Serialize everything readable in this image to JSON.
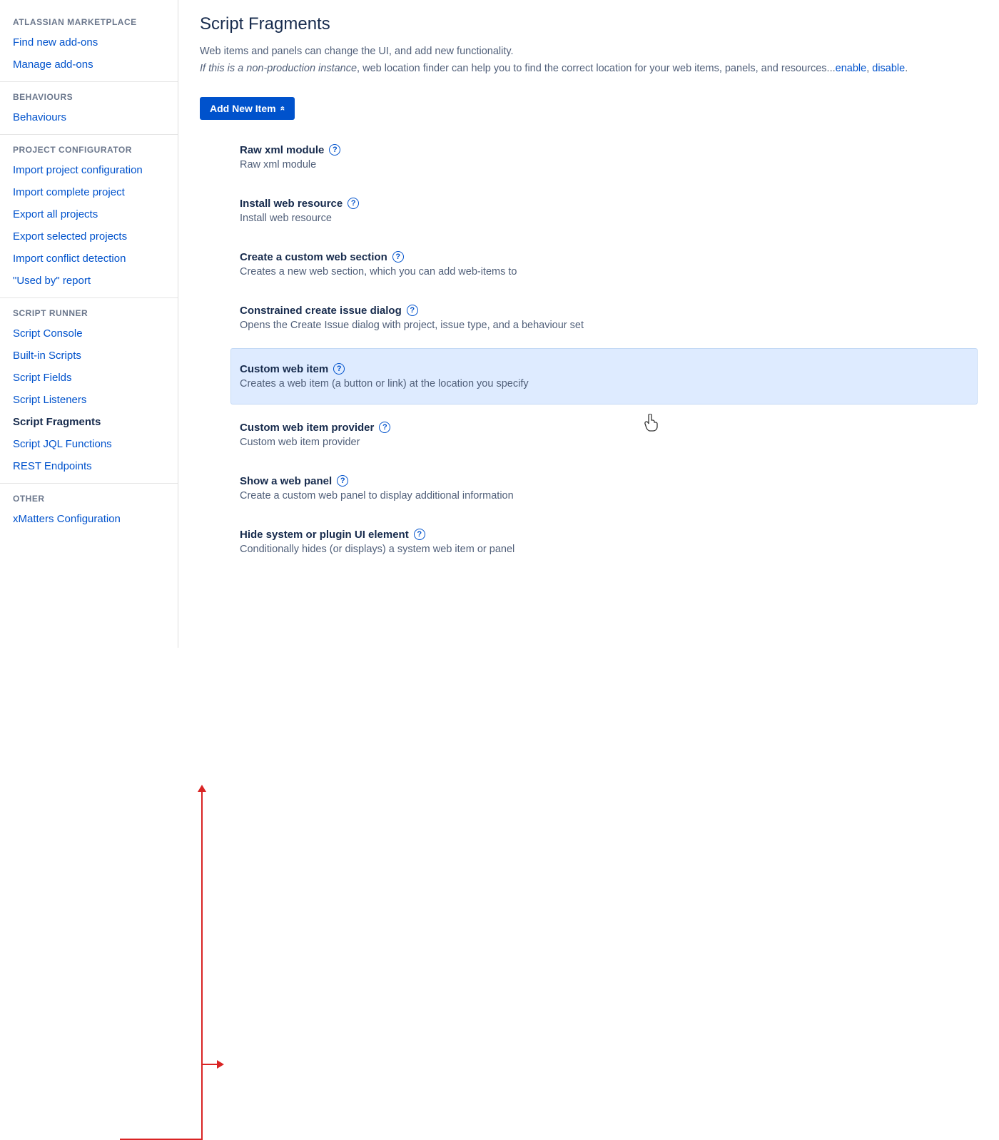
{
  "sidebar": {
    "groups": [
      {
        "header": "ATLASSIAN MARKETPLACE",
        "items": [
          {
            "label": "Find new add-ons",
            "name": "find-new-addons"
          },
          {
            "label": "Manage add-ons",
            "name": "manage-addons"
          }
        ]
      },
      {
        "header": "BEHAVIOURS",
        "items": [
          {
            "label": "Behaviours",
            "name": "behaviours"
          }
        ]
      },
      {
        "header": "PROJECT CONFIGURATOR",
        "items": [
          {
            "label": "Import project configuration",
            "name": "import-project-config"
          },
          {
            "label": "Import complete project",
            "name": "import-complete-project"
          },
          {
            "label": "Export all projects",
            "name": "export-all-projects"
          },
          {
            "label": "Export selected projects",
            "name": "export-selected-projects"
          },
          {
            "label": "Import conflict detection",
            "name": "import-conflict-detection"
          },
          {
            "label": "\"Used by\" report",
            "name": "used-by-report"
          }
        ]
      },
      {
        "header": "SCRIPT RUNNER",
        "items": [
          {
            "label": "Script Console",
            "name": "script-console"
          },
          {
            "label": "Built-in Scripts",
            "name": "builtin-scripts"
          },
          {
            "label": "Script Fields",
            "name": "script-fields"
          },
          {
            "label": "Script Listeners",
            "name": "script-listeners"
          },
          {
            "label": "Script Fragments",
            "name": "script-fragments",
            "active": true
          },
          {
            "label": "Script JQL Functions",
            "name": "script-jql-functions"
          },
          {
            "label": "REST Endpoints",
            "name": "rest-endpoints"
          }
        ]
      },
      {
        "header": "OTHER",
        "items": [
          {
            "label": "xMatters Configuration",
            "name": "xmatters-config"
          }
        ]
      }
    ]
  },
  "page": {
    "title": "Script Fragments",
    "intro": "Web items and panels can change the UI, and add new functionality.",
    "intro_italic": "If this is a non-production instance",
    "intro_rest": ", web location finder can help you to find the correct location for your web items, panels, and resources...",
    "enable_link": "enable",
    "disable_link": "disable",
    "add_button": "Add New Item"
  },
  "items": [
    {
      "title": "Raw xml module",
      "desc": "Raw xml module",
      "name": "raw-xml-module"
    },
    {
      "title": "Install web resource",
      "desc": "Install web resource",
      "name": "install-web-resource"
    },
    {
      "title": "Create a custom web section",
      "desc": "Creates a new web section, which you can add web-items to",
      "name": "create-custom-web-section"
    },
    {
      "title": "Constrained create issue dialog",
      "desc": "Opens the Create Issue dialog with project, issue type, and a behaviour set",
      "name": "constrained-create-issue"
    },
    {
      "title": "Custom web item",
      "desc": "Creates a web item (a button or link) at the location you specify",
      "name": "custom-web-item",
      "highlight": true
    },
    {
      "title": "Custom web item provider",
      "desc": "Custom web item provider",
      "name": "custom-web-item-provider"
    },
    {
      "title": "Show a web panel",
      "desc": "Create a custom web panel to display additional information",
      "name": "show-web-panel"
    },
    {
      "title": "Hide system or plugin UI element",
      "desc": "Conditionally hides (or displays) a system web item or panel",
      "name": "hide-ui-element"
    }
  ]
}
